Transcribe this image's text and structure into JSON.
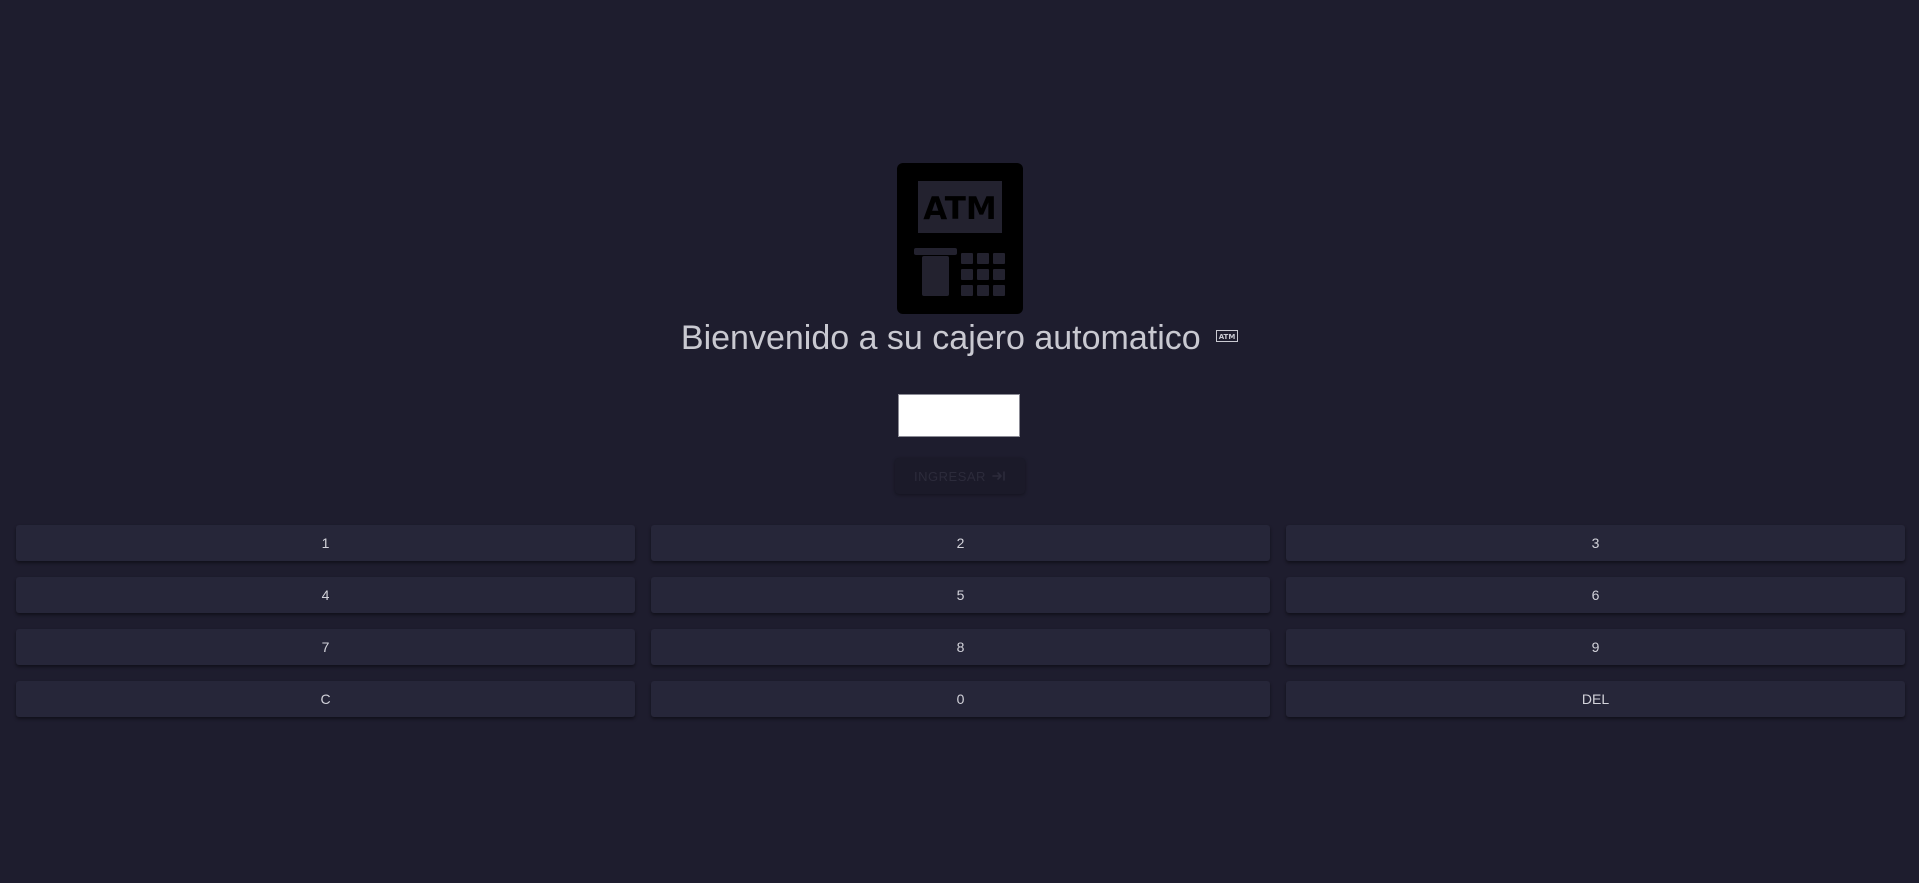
{
  "logo": {
    "label": "ATM",
    "icon": "atm-machine-icon"
  },
  "title": {
    "text": "Bienvenido a su cajero automatico",
    "icon": "atm-small-icon",
    "icon_label": "ATM"
  },
  "pin_input": {
    "value": "",
    "placeholder": ""
  },
  "submit_button": {
    "label": "INGRESAR",
    "icon": "enter-arrow-icon"
  },
  "keypad": {
    "keys": [
      "1",
      "2",
      "3",
      "4",
      "5",
      "6",
      "7",
      "8",
      "9",
      "C",
      "0",
      "DEL"
    ]
  },
  "colors": {
    "background": "#1e1d2e",
    "key_background": "#262639",
    "key_text": "#d2d2da",
    "title_text": "#c9c9d1",
    "logo": "#000000"
  }
}
